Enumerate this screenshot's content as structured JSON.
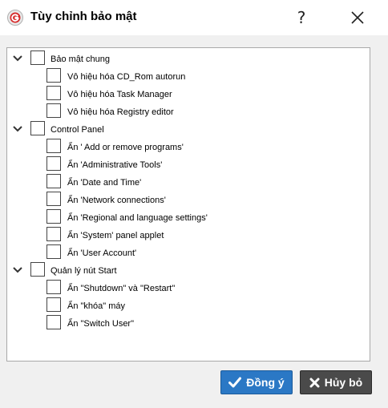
{
  "window": {
    "title": "Tùy chỉnh bảo mật",
    "help": "?",
    "icons": {
      "app": "garena-logo-icon",
      "close": "close-icon"
    }
  },
  "tree": [
    {
      "label": "Bảo mật chung",
      "checked": false,
      "expanded": true,
      "children": [
        {
          "label": "Vô hiệu hóa CD_Rom autorun",
          "checked": false
        },
        {
          "label": "Vô hiệu hóa Task Manager",
          "checked": false
        },
        {
          "label": "Vô hiệu hóa Registry editor",
          "checked": false
        }
      ]
    },
    {
      "label": "Control Panel",
      "checked": false,
      "expanded": true,
      "children": [
        {
          "label": "Ẩn ' Add or remove programs'",
          "checked": false
        },
        {
          "label": "Ẩn 'Administrative Tools'",
          "checked": false
        },
        {
          "label": "Ẩn 'Date and Time'",
          "checked": false
        },
        {
          "label": "Ẩn 'Network connections'",
          "checked": false
        },
        {
          "label": "Ẩn 'Regional and language settings'",
          "checked": false
        },
        {
          "label": "Ẩn 'System' panel applet",
          "checked": false
        },
        {
          "label": "Ẩn 'User Account'",
          "checked": false
        }
      ]
    },
    {
      "label": "Quản lý nút Start",
      "checked": false,
      "expanded": true,
      "children": [
        {
          "label": "Ẩn \"Shutdown\" và \"Restart\"",
          "checked": false
        },
        {
          "label": "Ẩn \"khóa\" máy",
          "checked": false
        },
        {
          "label": "Ẩn \"Switch User\"",
          "checked": false
        }
      ]
    }
  ],
  "buttons": {
    "ok_label": "Đồng ý",
    "cancel_label": "Hủy bỏ",
    "ok_icon": "check-icon",
    "cancel_icon": "x-icon",
    "ok_color": "#2b78c5",
    "cancel_color": "#4a4a4a"
  }
}
